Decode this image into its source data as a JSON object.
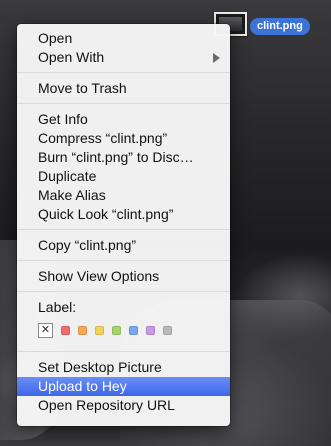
{
  "desktop": {
    "file_name": "clint.png"
  },
  "menu": {
    "open": "Open",
    "open_with": "Open With",
    "move_to_trash": "Move to Trash",
    "get_info": "Get Info",
    "compress": "Compress “clint.png”",
    "burn": "Burn “clint.png” to Disc…",
    "duplicate": "Duplicate",
    "make_alias": "Make Alias",
    "quick_look": "Quick Look “clint.png”",
    "copy": "Copy “clint.png”",
    "show_view_options": "Show View Options",
    "label_heading": "Label:",
    "label_none_glyph": "✕",
    "label_colors": [
      "#f26b6b",
      "#f5a85b",
      "#f2d25a",
      "#a6d56a",
      "#79a8ee",
      "#c79ae5",
      "#b9b9b9"
    ],
    "set_desktop_picture": "Set Desktop Picture",
    "upload_to_hey": "Upload to Hey",
    "open_repository_url": "Open Repository URL"
  },
  "colors": {
    "selection": "#3d67e8",
    "file_label_bg": "#3b74d6"
  }
}
